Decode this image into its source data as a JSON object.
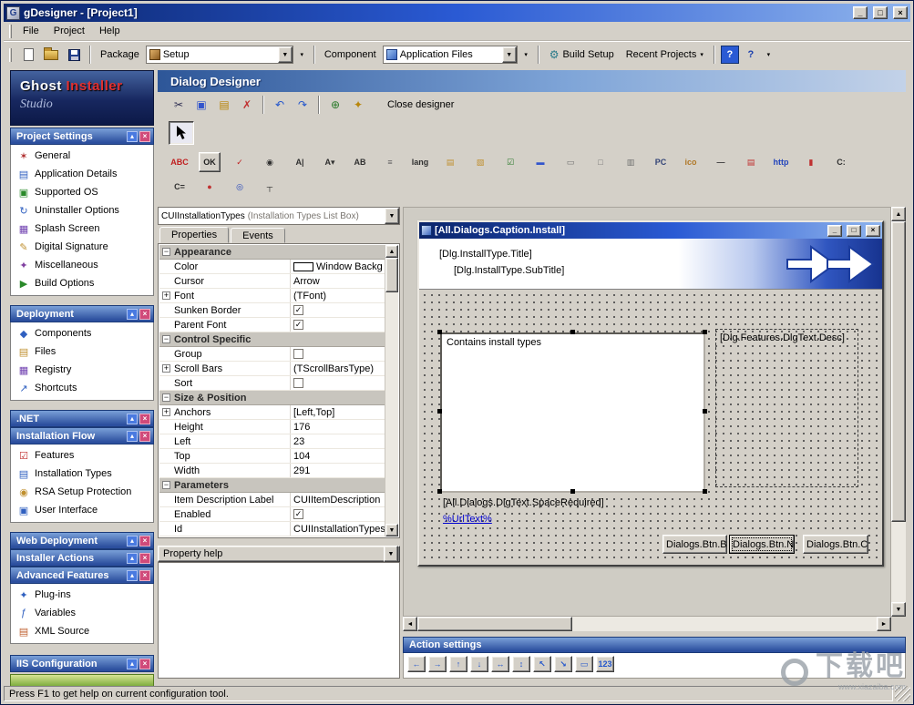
{
  "icons": {
    "app_glyph": "G",
    "minimize": "_",
    "maximize": "□",
    "close": "×",
    "dropdown": "▼",
    "small_arrow": "▾",
    "help": "?",
    "gear": "⚙",
    "collapse": "▴",
    "section_close": "×",
    "minus": "−",
    "plus": "+",
    "check": "✓",
    "up": "▲",
    "down": "▼",
    "left": "◄",
    "right": "►"
  },
  "titlebar": {
    "title": "gDesigner - [Project1]"
  },
  "menubar": {
    "items": [
      {
        "label": "File"
      },
      {
        "label": "Project"
      },
      {
        "label": "Help"
      }
    ]
  },
  "toolbar": {
    "package_label": "Package",
    "package_value": "Setup",
    "component_label": "Component",
    "component_value": "Application Files",
    "build_setup_label": "Build Setup",
    "recent_projects_label": "Recent Projects"
  },
  "logo": {
    "brand_primary": "Ghost",
    "brand_accent": "Installer",
    "brand_script": "Studio"
  },
  "sidebar": {
    "sections": [
      {
        "title": "Project Settings",
        "items": [
          {
            "label": "General",
            "icon": "✶",
            "color": "#b03030"
          },
          {
            "label": "Application Details",
            "icon": "▤",
            "color": "#3060c0"
          },
          {
            "label": "Supported OS",
            "icon": "▣",
            "color": "#2a8a2a"
          },
          {
            "label": "Uninstaller Options",
            "icon": "↻",
            "color": "#3060c0"
          },
          {
            "label": "Splash Screen",
            "icon": "▦",
            "color": "#7040b0"
          },
          {
            "label": "Digital Signature",
            "icon": "✎",
            "color": "#c09030"
          },
          {
            "label": "Miscellaneous",
            "icon": "✦",
            "color": "#8040a0"
          },
          {
            "label": "Build Options",
            "icon": "▶",
            "color": "#2a8a2a"
          }
        ]
      },
      {
        "title": "Deployment",
        "items": [
          {
            "label": "Components",
            "icon": "◆",
            "color": "#3060c0"
          },
          {
            "label": "Files",
            "icon": "▤",
            "color": "#c09030"
          },
          {
            "label": "Registry",
            "icon": "▦",
            "color": "#7040b0"
          },
          {
            "label": "Shortcuts",
            "icon": "↗",
            "color": "#3060c0"
          }
        ]
      },
      {
        "title": ".NET",
        "items": []
      },
      {
        "title": "Installation Flow",
        "items": [
          {
            "label": "Features",
            "icon": "☑",
            "color": "#c03030"
          },
          {
            "label": "Installation Types",
            "icon": "▤",
            "color": "#3060c0"
          },
          {
            "label": "RSA Setup Protection",
            "icon": "◉",
            "color": "#c09030"
          },
          {
            "label": "User Interface",
            "icon": "▣",
            "color": "#3060c0"
          }
        ]
      },
      {
        "title": "Web Deployment",
        "items": []
      },
      {
        "title": "Installer Actions",
        "items": []
      },
      {
        "title": "Advanced Features",
        "items": [
          {
            "label": "Plug-ins",
            "icon": "✦",
            "color": "#3060c0"
          },
          {
            "label": "Variables",
            "icon": "ƒ",
            "color": "#3060c0"
          },
          {
            "label": "XML Source",
            "icon": "▤",
            "color": "#c06030"
          }
        ]
      },
      {
        "title": "IIS Configuration",
        "items": []
      }
    ]
  },
  "designer": {
    "header": "Dialog Designer",
    "close_label": "Close designer",
    "toolbar_icons": [
      {
        "name": "cut",
        "glyph": "✂",
        "color": "#333355"
      },
      {
        "name": "copy",
        "glyph": "▣",
        "color": "#3355cc"
      },
      {
        "name": "paste",
        "glyph": "▤",
        "color": "#b8860b"
      },
      {
        "name": "delete",
        "glyph": "✗",
        "color": "#c03030"
      },
      {
        "name": "undo",
        "glyph": "↶",
        "color": "#2255cc"
      },
      {
        "name": "redo",
        "glyph": "↷",
        "color": "#2255cc"
      },
      {
        "name": "add-dialog",
        "glyph": "⊕",
        "color": "#2a7a2a"
      },
      {
        "name": "wand",
        "glyph": "✦",
        "color": "#b8860b"
      }
    ]
  },
  "palette": {
    "row1": [
      {
        "glyph": "ABC",
        "color": "#c02020"
      },
      {
        "glyph": "OK",
        "color": "#202020"
      },
      {
        "glyph": "✓",
        "color": "#c02020"
      },
      {
        "glyph": "◉",
        "color": "#303030"
      },
      {
        "glyph": "A|",
        "color": "#303030"
      },
      {
        "glyph": "A▾",
        "color": "#303030"
      },
      {
        "glyph": "AB",
        "color": "#303030"
      },
      {
        "glyph": "≡",
        "color": "#606060"
      },
      {
        "glyph": "lang",
        "color": "#303030"
      },
      {
        "glyph": "▤",
        "color": "#c09030"
      },
      {
        "glyph": "▧",
        "color": "#c09030"
      },
      {
        "glyph": "☑",
        "color": "#2a7a2a"
      },
      {
        "glyph": "▬",
        "color": "#3355cc"
      },
      {
        "glyph": "▭",
        "color": "#707070"
      },
      {
        "glyph": "□",
        "color": "#707070"
      },
      {
        "glyph": "▥",
        "color": "#707070"
      },
      {
        "glyph": "PC",
        "color": "#334477"
      },
      {
        "glyph": "ico",
        "color": "#b07828"
      },
      {
        "glyph": "—",
        "color": "#404040"
      },
      {
        "glyph": "▤",
        "color": "#c03030"
      },
      {
        "glyph": "http",
        "color": "#2244bb"
      },
      {
        "glyph": "▮",
        "color": "#c03030"
      },
      {
        "glyph": "C:",
        "color": "#303030"
      }
    ],
    "row2": [
      {
        "glyph": "C=",
        "color": "#303030"
      },
      {
        "glyph": "●",
        "color": "#c03030"
      },
      {
        "glyph": "◎",
        "color": "#2244bb"
      },
      {
        "glyph": "┬",
        "color": "#303030"
      }
    ]
  },
  "properties_panel": {
    "selector_value": "CUIInstallationTypes",
    "selector_hint": "(Installation Types List Box)",
    "tab_properties": "Properties",
    "tab_events": "Events",
    "groups": [
      {
        "name": "Appearance",
        "rows": [
          {
            "label": "Color",
            "value": "Window Backg"
          },
          {
            "label": "Cursor",
            "value": "Arrow"
          },
          {
            "label": "Font",
            "value": "(TFont)"
          },
          {
            "label": "Sunken Border"
          },
          {
            "label": "Parent Font"
          }
        ]
      },
      {
        "name": "Control Specific",
        "rows": [
          {
            "label": "Group"
          },
          {
            "label": "Scroll Bars",
            "value": "(TScrollBarsType)"
          },
          {
            "label": "Sort"
          }
        ]
      },
      {
        "name": "Size & Position",
        "rows": [
          {
            "label": "Anchors",
            "value": "[Left,Top]"
          },
          {
            "label": "Height",
            "value": "176"
          },
          {
            "label": "Left",
            "value": "23"
          },
          {
            "label": "Top",
            "value": "104"
          },
          {
            "label": "Width",
            "value": "291"
          }
        ]
      },
      {
        "name": "Parameters",
        "rows": [
          {
            "label": "Item Description Label",
            "value": "CUIItemDescription"
          },
          {
            "label": "Enabled"
          },
          {
            "label": "Id",
            "value": "CUIInstallationTypes"
          }
        ]
      }
    ],
    "help_label": "Property help"
  },
  "preview": {
    "title": "[All.Dialogs.Caption.Install]",
    "header_title": "[Dlg.InstallType.Title]",
    "header_subtitle": "[Dlg.InstallType.SubTitle]",
    "listbox_text": "Contains install types",
    "desc_label": "[Dlg.Features.DlgText.Desc]",
    "space_label": "[All.Dialogs.DlgText.SpaceRequired]",
    "url_text": "%UrlText%",
    "buttons": [
      {
        "label": "Dialogs.Btn.Ba"
      },
      {
        "label": "Dialogs.Btn.Ne"
      },
      {
        "label": "Dialogs.Btn.Car"
      }
    ]
  },
  "action_settings": {
    "title": "Action settings",
    "icons": [
      {
        "name": "align-left",
        "glyph": "←"
      },
      {
        "name": "align-right",
        "glyph": "→"
      },
      {
        "name": "align-top",
        "glyph": "↑"
      },
      {
        "name": "align-bottom",
        "glyph": "↓"
      },
      {
        "name": "center-horizontal",
        "glyph": "↔"
      },
      {
        "name": "center-vertical",
        "glyph": "↕"
      },
      {
        "name": "bring-to-front",
        "glyph": "↖"
      },
      {
        "name": "send-to-back",
        "glyph": "↘"
      },
      {
        "name": "size",
        "glyph": "▭"
      },
      {
        "name": "tab-order",
        "glyph": "123"
      }
    ]
  },
  "statusbar": {
    "text": "Press F1 to get help on current configuration tool."
  },
  "watermark": {
    "text": "下载吧",
    "url": "www.xiazaiba.com"
  }
}
